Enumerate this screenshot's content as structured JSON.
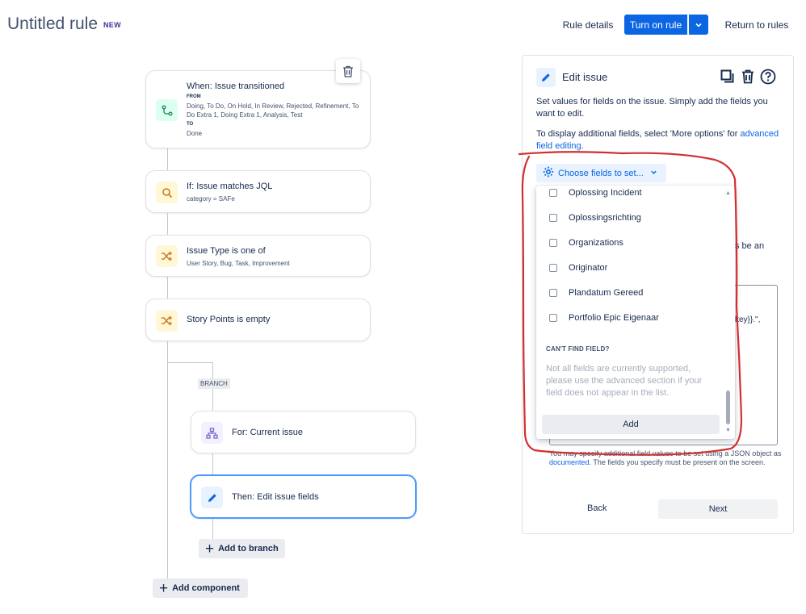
{
  "header": {
    "title": "Untitled rule",
    "badge": "NEW",
    "rule_details": "Rule details",
    "turn_on": "Turn on rule",
    "return_to_rules": "Return to rules"
  },
  "flow": {
    "trigger": {
      "title": "When: Issue transitioned",
      "from_label": "FROM",
      "from_value": "Doing, To Do, On Hold, In Review, Rejected, Refinement, To Do Extra 1, Doing Extra 1, Analysis, Test",
      "to_label": "TO",
      "to_value": "Done"
    },
    "condition_jql": {
      "title": "If: Issue matches JQL",
      "sub": "category = SAFe"
    },
    "condition_type": {
      "title": "Issue Type is one of",
      "sub": "User Story, Bug, Task, Improvement"
    },
    "condition_sp": {
      "title": "Story Points is empty"
    },
    "branch_label": "BRANCH",
    "branch_for": {
      "title": "For: Current issue"
    },
    "branch_then": {
      "title": "Then: Edit issue fields"
    },
    "add_to_branch": "Add to branch",
    "add_component": "Add component"
  },
  "panel": {
    "title": "Edit issue",
    "desc1": "Set values for fields on the issue. Simply add the fields you want to edit.",
    "desc2_prefix": "To display additional fields, select 'More options' for ",
    "desc2_link": "advanced field editing",
    "desc2_suffix": ".",
    "choose_fields": "Choose fields to set...",
    "partial_right_1": "s be an",
    "partial_right_2": "key}}.\",",
    "foot_prefix": "You may specify additional field values to be set using a JSON object as ",
    "foot_link": "documented",
    "foot_suffix": ". The fields you specify must be present on the screen.",
    "back": "Back",
    "next": "Next"
  },
  "dropdown": {
    "items": [
      "Oplossing Incident",
      "Oplossingsrichting",
      "Organizations",
      "Originator",
      "Plandatum Gereed",
      "Portfolio Epic Eigenaar"
    ],
    "cant_find_title": "CAN'T FIND FIELD?",
    "cant_find_desc": "Not all fields are currently supported, please use the advanced section if your field does not appear in the list.",
    "add": "Add"
  },
  "colors": {
    "primary": "#0c66e4",
    "annotation": "#d32f2f"
  }
}
